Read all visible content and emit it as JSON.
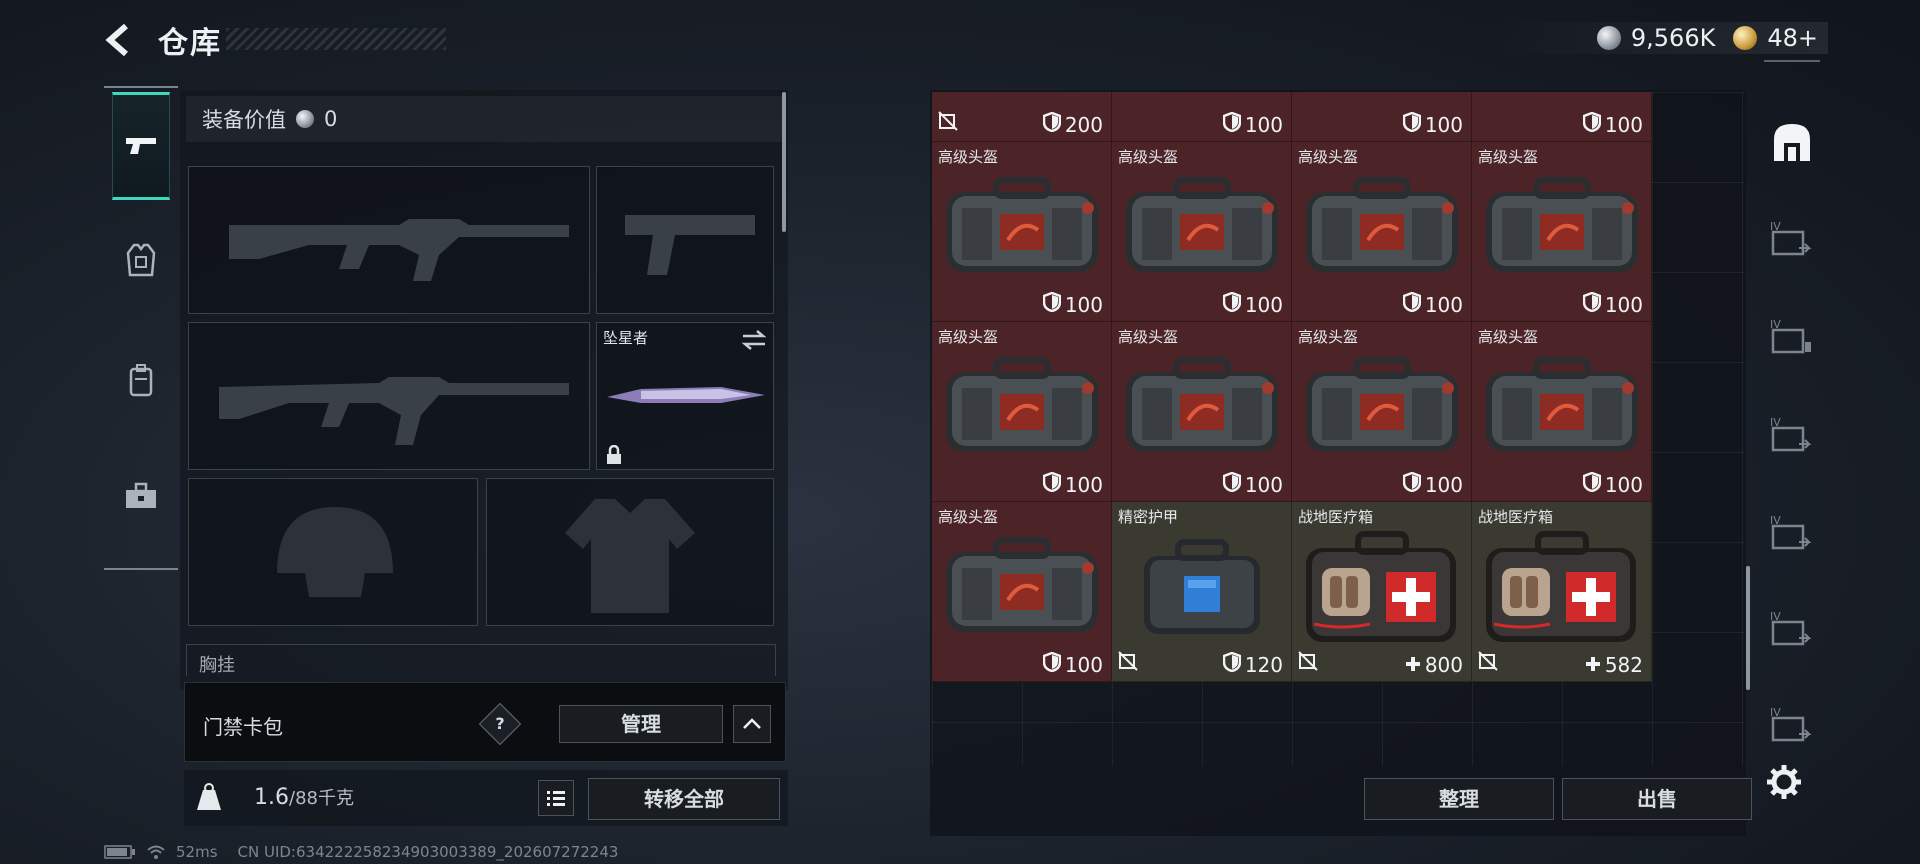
{
  "header": {
    "title": "仓库",
    "currency_silver": "9,566K",
    "currency_gold": "48+"
  },
  "loadout": {
    "equip_value_label": "装备价值",
    "equip_value": "0",
    "melee_name": "坠星者",
    "chest_label": "胸挂",
    "keycard_label": "门禁卡包",
    "help_glyph": "?",
    "manage_label": "管理",
    "weight_current": "1.6",
    "weight_max": "/88千克",
    "transfer_all_label": "转移全部"
  },
  "stash": {
    "top_row_stats": [
      "200",
      "100",
      "100",
      "100"
    ],
    "items": [
      {
        "name": "高级头盔",
        "stat": "100",
        "kind": "helmet"
      },
      {
        "name": "高级头盔",
        "stat": "100",
        "kind": "helmet"
      },
      {
        "name": "高级头盔",
        "stat": "100",
        "kind": "helmet"
      },
      {
        "name": "高级头盔",
        "stat": "100",
        "kind": "helmet"
      },
      {
        "name": "高级头盔",
        "stat": "100",
        "kind": "helmet"
      },
      {
        "name": "高级头盔",
        "stat": "100",
        "kind": "helmet"
      },
      {
        "name": "高级头盔",
        "stat": "100",
        "kind": "helmet"
      },
      {
        "name": "高级头盔",
        "stat": "100",
        "kind": "helmet"
      },
      {
        "name": "高级头盔",
        "stat": "100",
        "kind": "helmet"
      },
      {
        "name": "精密护甲",
        "stat": "120",
        "kind": "armor"
      },
      {
        "name": "战地医疗箱",
        "stat": "800",
        "kind": "med"
      },
      {
        "name": "战地医疗箱",
        "stat": "582",
        "kind": "med"
      }
    ],
    "sort_label": "整理",
    "sell_label": "出售"
  },
  "status": {
    "ping": "52ms",
    "uid": "CN UID:634222258234903003389_202607272243"
  },
  "icons": {
    "back": "back-arrow-icon",
    "currency_silver": "silver-coin-icon",
    "currency_gold": "gold-coin-icon",
    "durability": "shield-icon",
    "heal": "plus-icon",
    "no_insure": "no-insure-icon"
  },
  "colors": {
    "accent": "#3ed7c0",
    "helmet_bg": "#4c2428",
    "item_bg": "#3b3a30"
  }
}
